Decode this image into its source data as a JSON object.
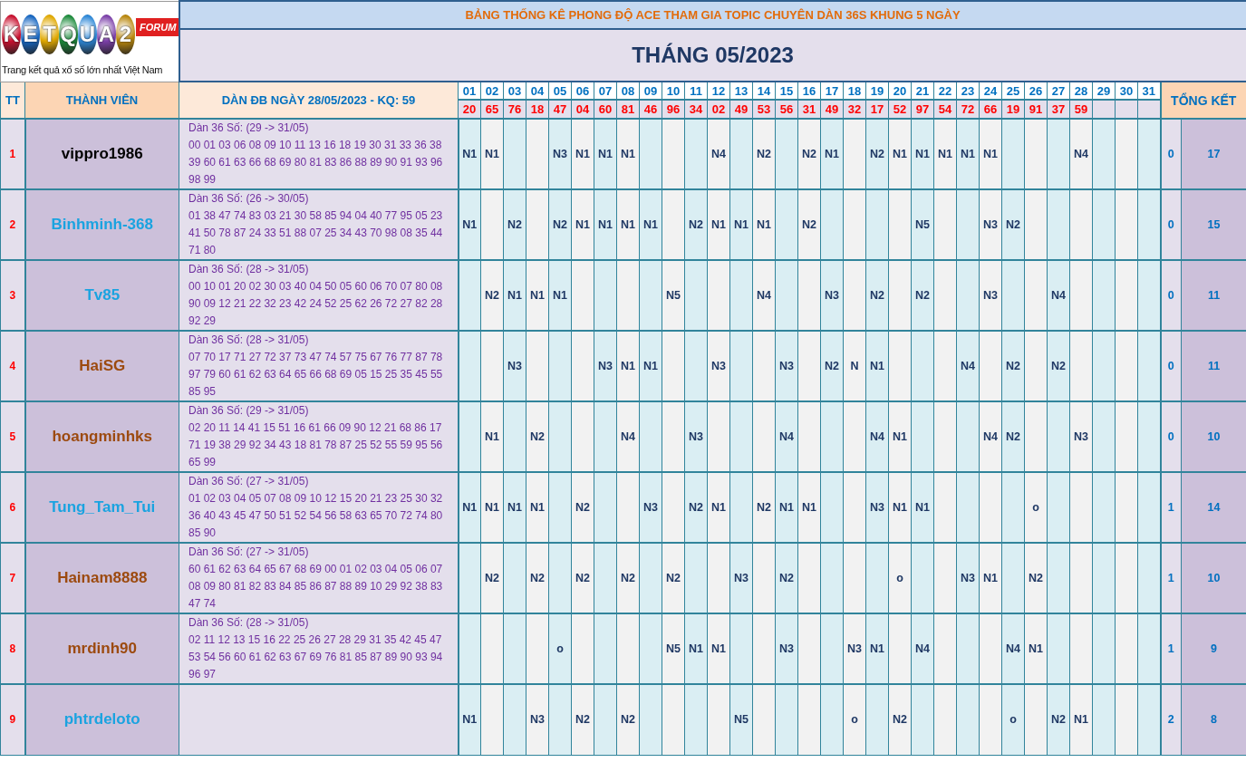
{
  "logo": {
    "letters": [
      "K",
      "E",
      "T",
      "Q",
      "U",
      "A",
      "2"
    ],
    "badge": "FORUM",
    "tagline": "Trang kết quả xổ số lớn nhất Việt Nam"
  },
  "title": "BẢNG THỐNG KÊ PHONG ĐỘ ACE THAM GIA TOPIC CHUYÊN DÀN 36S KHUNG 5 NGÀY",
  "month": "THÁNG 05/2023",
  "columns": {
    "tt": "TT",
    "member": "THÀNH VIÊN",
    "dan": "DÀN ĐB NGÀY 28/05/2023 - KQ: 59",
    "summary": "TỔNG KẾT"
  },
  "days": [
    {
      "day": "01",
      "result": "20"
    },
    {
      "day": "02",
      "result": "65"
    },
    {
      "day": "03",
      "result": "76"
    },
    {
      "day": "04",
      "result": "18"
    },
    {
      "day": "05",
      "result": "47"
    },
    {
      "day": "06",
      "result": "04"
    },
    {
      "day": "07",
      "result": "60"
    },
    {
      "day": "08",
      "result": "81"
    },
    {
      "day": "09",
      "result": "46"
    },
    {
      "day": "10",
      "result": "96"
    },
    {
      "day": "11",
      "result": "34"
    },
    {
      "day": "12",
      "result": "02"
    },
    {
      "day": "13",
      "result": "49"
    },
    {
      "day": "14",
      "result": "53"
    },
    {
      "day": "15",
      "result": "56"
    },
    {
      "day": "16",
      "result": "31"
    },
    {
      "day": "17",
      "result": "49"
    },
    {
      "day": "18",
      "result": "32"
    },
    {
      "day": "19",
      "result": "17"
    },
    {
      "day": "20",
      "result": "52"
    },
    {
      "day": "21",
      "result": "97"
    },
    {
      "day": "22",
      "result": "54"
    },
    {
      "day": "23",
      "result": "72"
    },
    {
      "day": "24",
      "result": "66"
    },
    {
      "day": "25",
      "result": "19"
    },
    {
      "day": "26",
      "result": "91"
    },
    {
      "day": "27",
      "result": "37"
    },
    {
      "day": "28",
      "result": "59"
    },
    {
      "day": "29"
    },
    {
      "day": "30"
    },
    {
      "day": "31"
    }
  ],
  "rows": [
    {
      "tt": "1",
      "name": "vippro1986",
      "color": "#000000",
      "range": "Dàn 36 Số: (29 -> 31/05)",
      "numbers": "00 01 03 06 08 09 10 11 13 16 18 19 30 31 33 36 38 39 60 61 63 66 68 69 80 81 83 86 88 89 90 91 93 96 98 99",
      "cells": [
        "N1",
        "N1",
        null,
        null,
        "N3",
        "N1",
        "N1",
        "N1",
        null,
        null,
        null,
        "N4",
        null,
        "N2",
        null,
        "N2",
        "N1",
        null,
        "N2",
        "N1",
        "N1",
        "N1",
        "N1",
        "N1",
        null,
        null,
        null,
        "N4",
        null,
        null,
        null
      ],
      "summary_col_1": "0",
      "summary_col_2": "17"
    },
    {
      "tt": "2",
      "name": "Binhminh-368",
      "color": "#1aa3e0",
      "range": "Dàn 36 Số: (26 -> 30/05)",
      "numbers": "01 38 47 74 83 03 21 30 58 85 94 04 40 77 95 05 23 41 50 78 87 24 33 51 88 07 25 34 43 70 98 08 35 44 71 80",
      "cells": [
        "N1",
        null,
        "N2",
        null,
        "N2",
        "N1",
        "N1",
        "N1",
        "N1",
        null,
        "N2",
        "N1",
        "N1",
        "N1",
        null,
        "N2",
        null,
        null,
        null,
        null,
        "N5",
        null,
        null,
        "N3",
        "N2",
        null,
        null,
        null,
        null,
        null,
        null
      ],
      "summary_col_1": "0",
      "summary_col_2": "15"
    },
    {
      "tt": "3",
      "name": "Tv85",
      "color": "#1aa3e0",
      "range": "Dàn 36 Số: (28 -> 31/05)",
      "numbers": "00 10 01 20 02 30 03 40 04 50 05 60 06 70 07 80 08 90 09 12 21 22 32 23 42 24 52 25 62 26 72 27 82 28 92 29",
      "cells": [
        null,
        "N2",
        "N1",
        "N1",
        "N1",
        null,
        null,
        null,
        null,
        "N5",
        null,
        null,
        null,
        "N4",
        null,
        null,
        "N3",
        null,
        "N2",
        null,
        "N2",
        null,
        null,
        "N3",
        null,
        null,
        "N4",
        null,
        null,
        null,
        null
      ],
      "summary_col_1": "0",
      "summary_col_2": "11"
    },
    {
      "tt": "4",
      "name": "HaiSG",
      "color": "#9c4a0f",
      "range": "Dàn 36 Số: (28 -> 31/05)",
      "numbers": "07 70 17 71 27 72 37 73 47 74 57 75 67 76 77 87 78 97 79 60 61 62 63 64 65 66 68 69 05 15 25 35 45 55 85 95",
      "cells": [
        null,
        null,
        "N3",
        null,
        null,
        null,
        "N3",
        "N1",
        "N1",
        null,
        null,
        "N3",
        null,
        null,
        "N3",
        null,
        "N2",
        "N",
        "N1",
        null,
        null,
        null,
        "N4",
        null,
        "N2",
        null,
        "N2",
        null,
        null,
        null,
        null
      ],
      "summary_col_1": "0",
      "summary_col_2": "11"
    },
    {
      "tt": "5",
      "name": "hoangminhks",
      "color": "#9c4a0f",
      "range": "Dàn 36 Số: (29 -> 31/05)",
      "numbers": "02 20 11 14 41 15 51 16 61 66 09 90 12 21 68 86 17 71 19 38 29 92 34 43 18 81 78 87 25 52 55 59 95 56 65 99",
      "cells": [
        null,
        "N1",
        null,
        "N2",
        null,
        null,
        null,
        "N4",
        null,
        null,
        "N3",
        null,
        null,
        null,
        "N4",
        null,
        null,
        null,
        "N4",
        "N1",
        null,
        null,
        null,
        "N4",
        "N2",
        null,
        null,
        "N3",
        null,
        null,
        null
      ],
      "summary_col_1": "0",
      "summary_col_2": "10"
    },
    {
      "tt": "6",
      "name": "Tung_Tam_Tui",
      "color": "#1aa3e0",
      "range": "Dàn 36 Số: (27 -> 31/05)",
      "numbers": "01 02 03 04 05 07 08 09 10 12 15 20 21 23 25 30 32 36 40 43 45 47 50 51 52 54 56 58 63 65 70 72 74 80 85 90",
      "cells": [
        "N1",
        "N1",
        "N1",
        "N1",
        null,
        "N2",
        null,
        null,
        "N3",
        null,
        "N2",
        "N1",
        null,
        "N2",
        "N1",
        "N1",
        null,
        null,
        "N3",
        "N1",
        "N1",
        null,
        null,
        null,
        null,
        "o",
        null,
        null,
        null,
        null,
        null
      ],
      "summary_col_1": "1",
      "summary_col_2": "14"
    },
    {
      "tt": "7",
      "name": "Hainam8888",
      "color": "#9c4a0f",
      "range": "Dàn 36 Số: (27 -> 31/05)",
      "numbers": "60 61 62 63 64 65 67 68 69 00 01 02 03 04 05 06 07 08 09 80 81 82 83 84 85 86 87 88 89 10 29 92 38 83 47 74",
      "cells": [
        null,
        "N2",
        null,
        "N2",
        null,
        "N2",
        null,
        "N2",
        null,
        "N2",
        null,
        null,
        "N3",
        null,
        "N2",
        null,
        null,
        null,
        null,
        "o",
        null,
        null,
        "N3",
        "N1",
        null,
        "N2",
        null,
        null,
        null,
        null,
        null
      ],
      "summary_col_1": "1",
      "summary_col_2": "10"
    },
    {
      "tt": "8",
      "name": "mrdinh90",
      "color": "#9c4a0f",
      "range": "Dàn 36 Số: (28 -> 31/05)",
      "numbers": "02 11 12 13 15 16 22 25 26 27 28 29 31 35 42 45 47 53 54 56 60 61 62 63 67 69 76 81 85 87 89 90 93 94 96 97",
      "cells": [
        null,
        null,
        null,
        null,
        "o",
        null,
        null,
        null,
        null,
        "N5",
        "N1",
        "N1",
        null,
        null,
        "N3",
        null,
        null,
        "N3",
        "N1",
        null,
        "N4",
        null,
        null,
        null,
        "N4",
        "N1",
        null,
        null,
        null,
        null,
        null
      ],
      "summary_col_1": "1",
      "summary_col_2": "9"
    },
    {
      "tt": "9",
      "name": "phtrdeloto",
      "color": "#1aa3e0",
      "cells": [
        "N1",
        null,
        null,
        "N3",
        null,
        "N2",
        null,
        "N2",
        null,
        null,
        null,
        null,
        "N5",
        null,
        null,
        null,
        null,
        "o",
        null,
        "N2",
        null,
        null,
        null,
        null,
        "o",
        null,
        "N2",
        "N1",
        null,
        null,
        null
      ],
      "summary_col_1": "2",
      "summary_col_2": "8"
    }
  ]
}
